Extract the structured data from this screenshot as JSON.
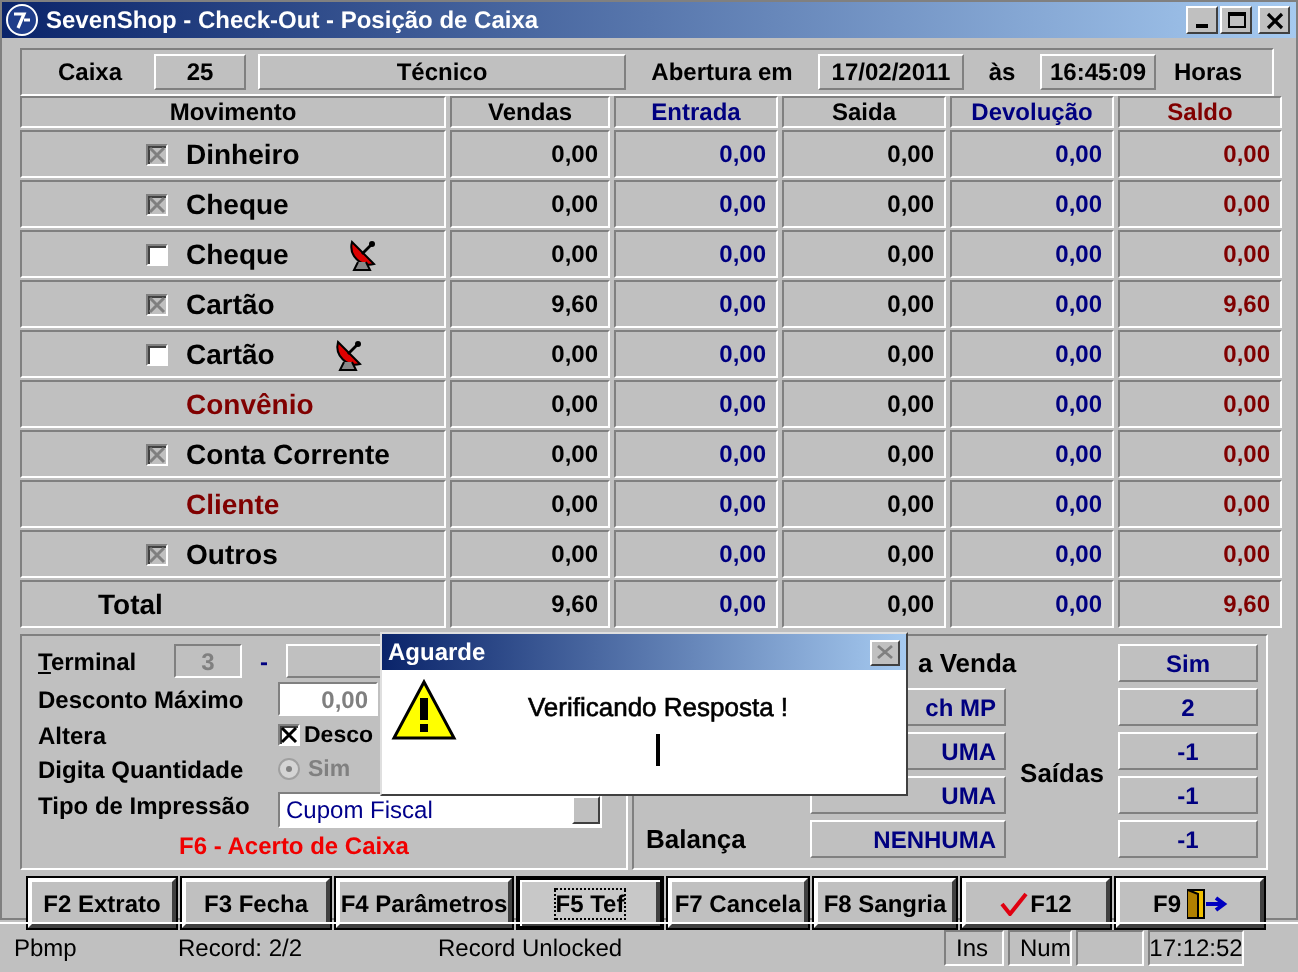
{
  "window": {
    "title": "SevenShop - Check-Out - Posição de Caixa"
  },
  "header": {
    "caixa_label": "Caixa",
    "caixa": "25",
    "operator": "Técnico",
    "opening_label": "Abertura em",
    "date": "17/02/2011",
    "at_label": "às",
    "time": "16:45:09",
    "hours_label": "Horas"
  },
  "table": {
    "columns": [
      {
        "label": "Movimento",
        "color": "#000000"
      },
      {
        "label": "Vendas",
        "color": "#000000"
      },
      {
        "label": "Entrada",
        "color": "#000080"
      },
      {
        "label": "Saida",
        "color": "#000000"
      },
      {
        "label": "Devolução",
        "color": "#000080"
      },
      {
        "label": "Saldo",
        "color": "#800000"
      }
    ],
    "rows": [
      {
        "kind": "checkbox",
        "label": "Dinheiro",
        "checked": true,
        "antenna": false,
        "values": [
          "0,00",
          "0,00",
          "0,00",
          "0,00",
          "0,00"
        ]
      },
      {
        "kind": "checkbox",
        "label": "Cheque",
        "checked": true,
        "antenna": false,
        "values": [
          "0,00",
          "0,00",
          "0,00",
          "0,00",
          "0,00"
        ]
      },
      {
        "kind": "checkbox",
        "label": "Cheque",
        "checked": false,
        "antenna": true,
        "values": [
          "0,00",
          "0,00",
          "0,00",
          "0,00",
          "0,00"
        ]
      },
      {
        "kind": "checkbox",
        "label": "Cartão",
        "checked": true,
        "antenna": false,
        "values": [
          "9,60",
          "0,00",
          "0,00",
          "0,00",
          "9,60"
        ]
      },
      {
        "kind": "checkbox",
        "label": "Cartão",
        "checked": false,
        "antenna": true,
        "values": [
          "0,00",
          "0,00",
          "0,00",
          "0,00",
          "0,00"
        ]
      },
      {
        "kind": "heading",
        "label": "Convênio",
        "values": [
          "0,00",
          "0,00",
          "0,00",
          "0,00",
          "0,00"
        ]
      },
      {
        "kind": "checkbox",
        "label": "Conta Corrente",
        "checked": true,
        "antenna": false,
        "values": [
          "0,00",
          "0,00",
          "0,00",
          "0,00",
          "0,00"
        ]
      },
      {
        "kind": "heading",
        "label": "Cliente",
        "values": [
          "0,00",
          "0,00",
          "0,00",
          "0,00",
          "0,00"
        ]
      },
      {
        "kind": "checkbox",
        "label": "Outros",
        "checked": true,
        "antenna": false,
        "values": [
          "0,00",
          "0,00",
          "0,00",
          "0,00",
          "0,00"
        ]
      }
    ],
    "total": {
      "label": "Total",
      "values": [
        "9,60",
        "0,00",
        "0,00",
        "0,00",
        "9,60"
      ]
    }
  },
  "settings": {
    "terminal_label": "Terminal",
    "terminal": "3",
    "dash": "-",
    "discount_label": "Desconto Máximo",
    "discount": "0,00",
    "alter_label": "Altera",
    "alter_option": {
      "label": "Desco",
      "checked": true
    },
    "qty_label": "Digita Quantidade",
    "qty_option": {
      "label": "Sim",
      "selected": true,
      "disabled": true
    },
    "print_label": "Tipo de Impressão",
    "print_type": "Cupom Fiscal",
    "shortcut": "F6 - Acerto de Caixa"
  },
  "devices": {
    "sale_label": "a Venda",
    "sale_value": "Sim",
    "rows": [
      {
        "device": "ch MP",
        "value": "2"
      },
      {
        "device": "UMA",
        "value": "-1"
      },
      {
        "device": "UMA",
        "value": "-1"
      },
      {
        "label": "Balança",
        "device": "NENHUMA",
        "value": "-1"
      }
    ],
    "outputs_label": "Saídas"
  },
  "buttons": [
    {
      "label": "F2 Extrato",
      "focused": false
    },
    {
      "label": "F3 Fecha",
      "focused": false
    },
    {
      "label": "F4 Parâmetros",
      "focused": false
    },
    {
      "label": "F5 Tef",
      "focused": true
    },
    {
      "label": "F7 Cancela",
      "focused": false
    },
    {
      "label": "F8 Sangria",
      "focused": false
    },
    {
      "kind": "check",
      "label": "F12",
      "focused": false
    },
    {
      "kind": "exit",
      "label": "F9",
      "focused": false
    }
  ],
  "dialog": {
    "title": "Aguarde",
    "message": "Verificando Resposta !"
  },
  "status_bar": [
    "Pbmp",
    "Record: 2/2",
    "Record Unlocked",
    "Ins",
    "Num",
    "17:12:52"
  ]
}
